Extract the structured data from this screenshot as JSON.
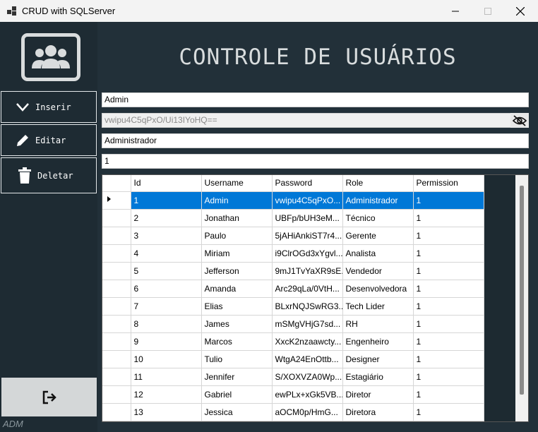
{
  "window": {
    "title": "CRUD with SQLServer",
    "controls": [
      "minimize-icon",
      "maximize-icon",
      "close-icon"
    ]
  },
  "sidebar": {
    "logo_icon": "users-group-icon",
    "buttons": [
      {
        "label": "Inserir",
        "icon": "chevron-down-icon"
      },
      {
        "label": "Editar",
        "icon": "pencil-icon"
      },
      {
        "label": "Deletar",
        "icon": "trash-icon"
      }
    ],
    "logout_icon": "logout-icon",
    "footer_label": "ADM"
  },
  "main": {
    "title": "CONTROLE DE USUÁRIOS",
    "fields": {
      "username": "Admin",
      "password": "vwipu4C5qPxO/Ui13IYoHQ==",
      "role": "Administrador",
      "permission": "1"
    },
    "grid": {
      "columns": [
        "Id",
        "Username",
        "Password",
        "Role",
        "Permission"
      ],
      "selected_row": 0,
      "rows": [
        [
          "1",
          "Admin",
          "vwipu4C5qPxO...",
          "Administrador",
          "1"
        ],
        [
          "2",
          "Jonathan",
          "UBFp/bUH3eM...",
          "Técnico",
          "1"
        ],
        [
          "3",
          "Paulo",
          "5jAHiAnkiST7r4...",
          "Gerente",
          "1"
        ],
        [
          "4",
          "Miriam",
          "i9ClrOGd3xYgvl...",
          "Analista",
          "1"
        ],
        [
          "5",
          "Jefferson",
          "9mJ1TvYaXR9sE...",
          "Vendedor",
          "1"
        ],
        [
          "6",
          "Amanda",
          "Arc29qLa/0VtH...",
          "Desenvolvedora",
          "1"
        ],
        [
          "7",
          "Elias",
          "BLxrNQJSwRG3...",
          "Tech Lider",
          "1"
        ],
        [
          "8",
          "James",
          "mSMgVHjG7sd...",
          "RH",
          "1"
        ],
        [
          "9",
          "Marcos",
          "XxcK2nzaawcty...",
          "Engenheiro",
          "1"
        ],
        [
          "10",
          "Tulio",
          "WtgA24EnOttb...",
          "Designer",
          "1"
        ],
        [
          "11",
          "Jennifer",
          "S/XOXVZA0Wp...",
          "Estagiário",
          "1"
        ],
        [
          "12",
          "Gabriel",
          "ewPLx+xGk5VB...",
          "Diretor",
          "1"
        ],
        [
          "13",
          "Jessica",
          "aOCM0p/HmG...",
          "Diretora",
          "1"
        ]
      ]
    }
  },
  "colors": {
    "sidebar_bg": "#1e2b33",
    "main_bg": "#223039",
    "selection": "#0078d7"
  }
}
